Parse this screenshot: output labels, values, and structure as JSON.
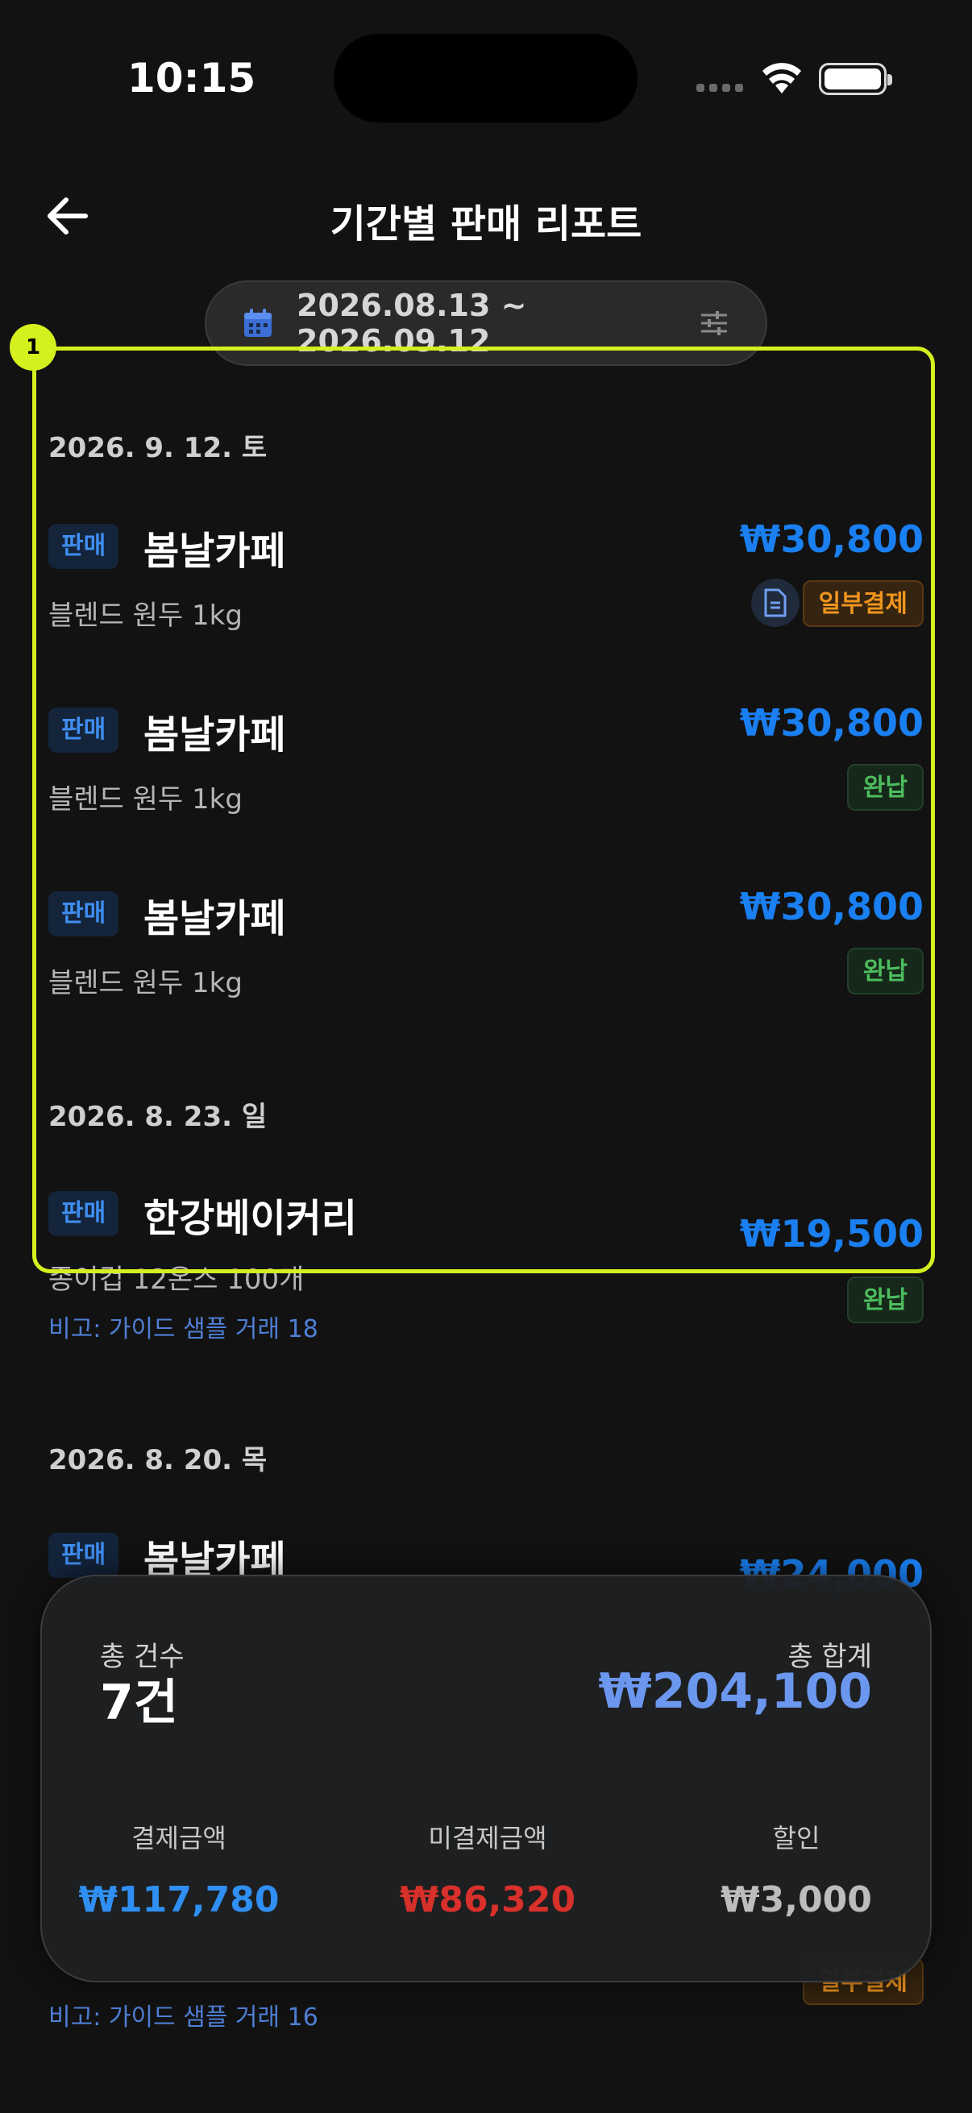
{
  "status_bar": {
    "time": "10:15"
  },
  "header": {
    "title": "기간별 판매 리포트"
  },
  "date_filter": {
    "range": "2026.08.13 ~ 2026.09.12"
  },
  "annotation": {
    "badge": "1"
  },
  "groups": [
    {
      "date": "2026. 9. 12. 토",
      "items": [
        {
          "tag": "판매",
          "store": "봄날카페",
          "product": "블렌드 원두 1kg",
          "amount": "₩30,800",
          "status": "일부결제",
          "has_doc": true
        },
        {
          "tag": "판매",
          "store": "봄날카페",
          "product": "블렌드 원두 1kg",
          "amount": "₩30,800",
          "status": "완납"
        },
        {
          "tag": "판매",
          "store": "봄날카페",
          "product": "블렌드 원두 1kg",
          "amount": "₩30,800",
          "status": "완납"
        }
      ]
    },
    {
      "date": "2026. 8. 23. 일",
      "items": [
        {
          "tag": "판매",
          "store": "한강베이커리",
          "product": "종이컵 12온스 100개",
          "amount": "₩19,500",
          "status": "완납",
          "note": "비고: 가이드 샘플 거래 18"
        }
      ]
    },
    {
      "date": "2026. 8. 20. 목",
      "items": [
        {
          "tag": "판매",
          "store": "봄날카페",
          "amount": "₩24,000"
        }
      ]
    }
  ],
  "peek_below": {
    "status": "일부결제",
    "note": "비고: 가이드 샘플 거래 16"
  },
  "summary": {
    "count_label": "총 건수",
    "count_value": "7건",
    "total_label": "총 합계",
    "total_value": "₩204,100",
    "paid_label": "결제금액",
    "paid_value": "₩117,780",
    "unpaid_label": "미결제금액",
    "unpaid_value": "₩86,320",
    "discount_label": "할인",
    "discount_value": "₩3,000"
  },
  "colors": {
    "accent_blue": "#1a7ff0",
    "paid_green": "#4dbd5d",
    "partial_orange": "#f0951e",
    "unpaid_red": "#d8302a",
    "highlight": "#d4f01e"
  }
}
